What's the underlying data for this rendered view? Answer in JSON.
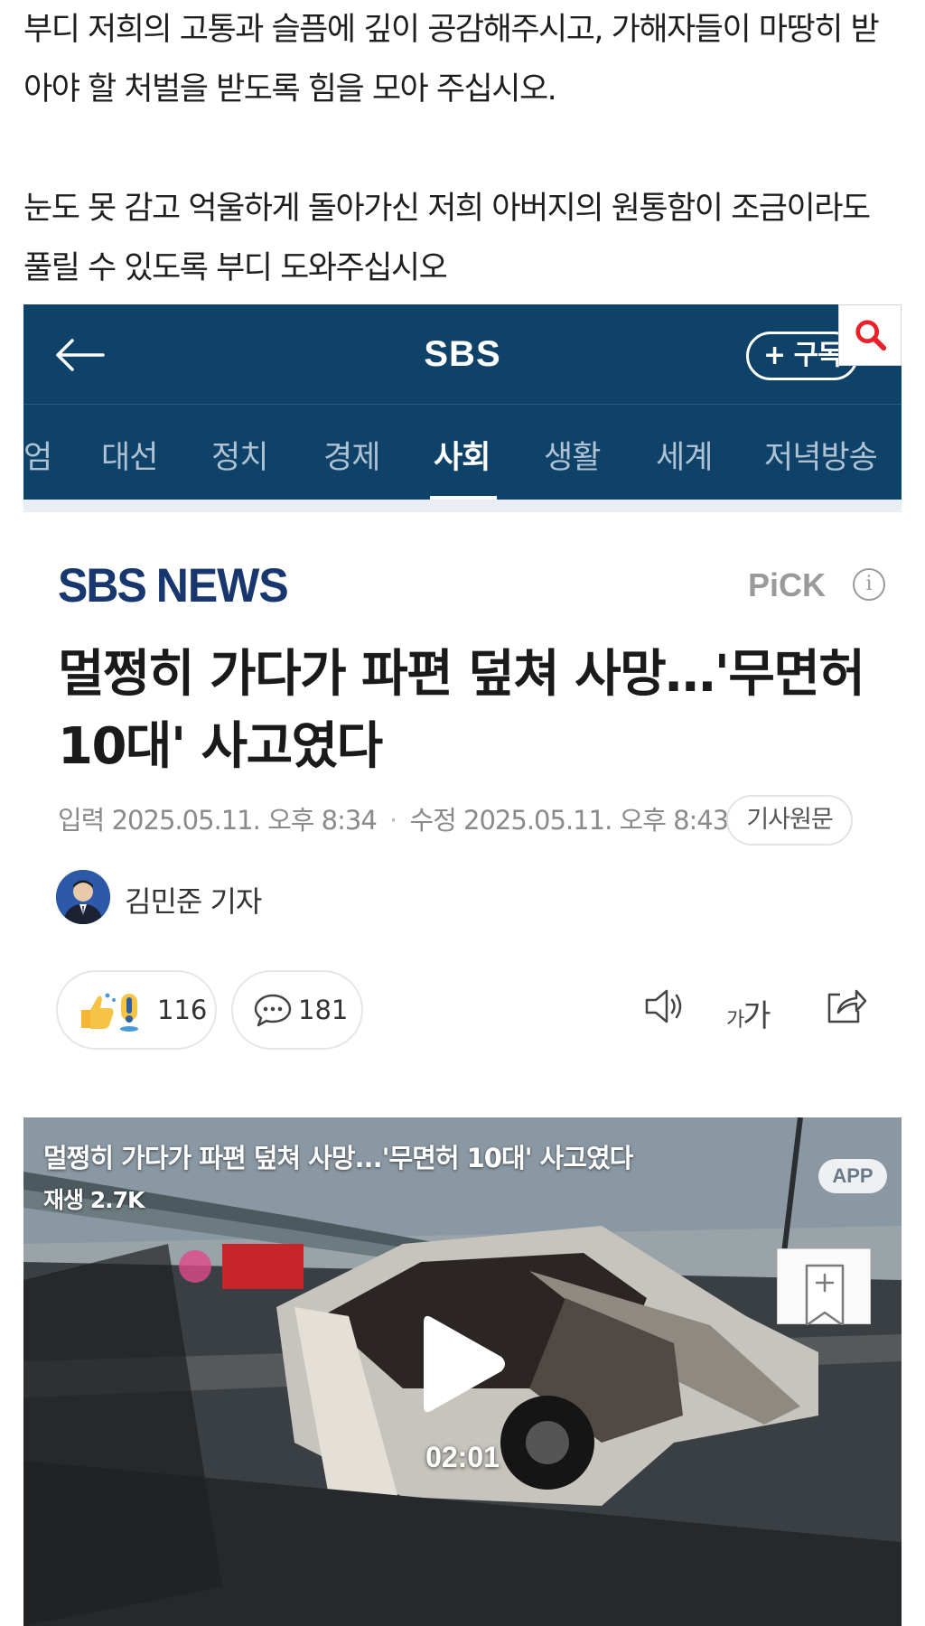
{
  "petition": {
    "paragraph1": "부디 저희의 고통과 슬픔에 깊이 공감해주시고, 가해자들이 마땅히 받아야 할 처벌을 받도록 힘을 모아 주십시오.",
    "paragraph2": "눈도 못 감고 억울하게 돌아가신 저희 아버지의 원통함이 조금이라도 풀릴 수 있도록 부디 도와주십시오"
  },
  "app_bar": {
    "title": "SBS",
    "subscribe_label": "+ 구독",
    "back_icon": "arrow-left-icon",
    "search_icon": "search-icon"
  },
  "tabs": [
    {
      "label": "엄"
    },
    {
      "label": "대선"
    },
    {
      "label": "정치"
    },
    {
      "label": "경제"
    },
    {
      "label": "사회",
      "active": true
    },
    {
      "label": "생활"
    },
    {
      "label": "세계"
    },
    {
      "label": "저녁방송"
    }
  ],
  "article": {
    "logo_main": "SBS",
    "logo_sub": "NEWS",
    "pick_label": "PiCK",
    "headline": "멀쩡히 가다가 파편 덮쳐 사망…'무면허 10대' 사고였다",
    "input_label": "입력",
    "input_time": "2025.05.11. 오후 8:34",
    "modified_label": "수정",
    "modified_time": "2025.05.11. 오후 8:43",
    "original_label": "기사원문",
    "reporter": "김민준 기자",
    "reaction_count": "116",
    "comment_count": "181",
    "font_size_label_small": "가",
    "font_size_label_large": "가"
  },
  "video": {
    "title": "멀쩡히 가다가 파편 덮쳐 사망...'무면허 10대' 사고였다",
    "views": "재생 2.7K",
    "app_badge": "APP",
    "duration": "02:01"
  },
  "colors": {
    "navy": "#0f4268",
    "logo_blue": "#17376e",
    "search_red": "#e8202a"
  }
}
